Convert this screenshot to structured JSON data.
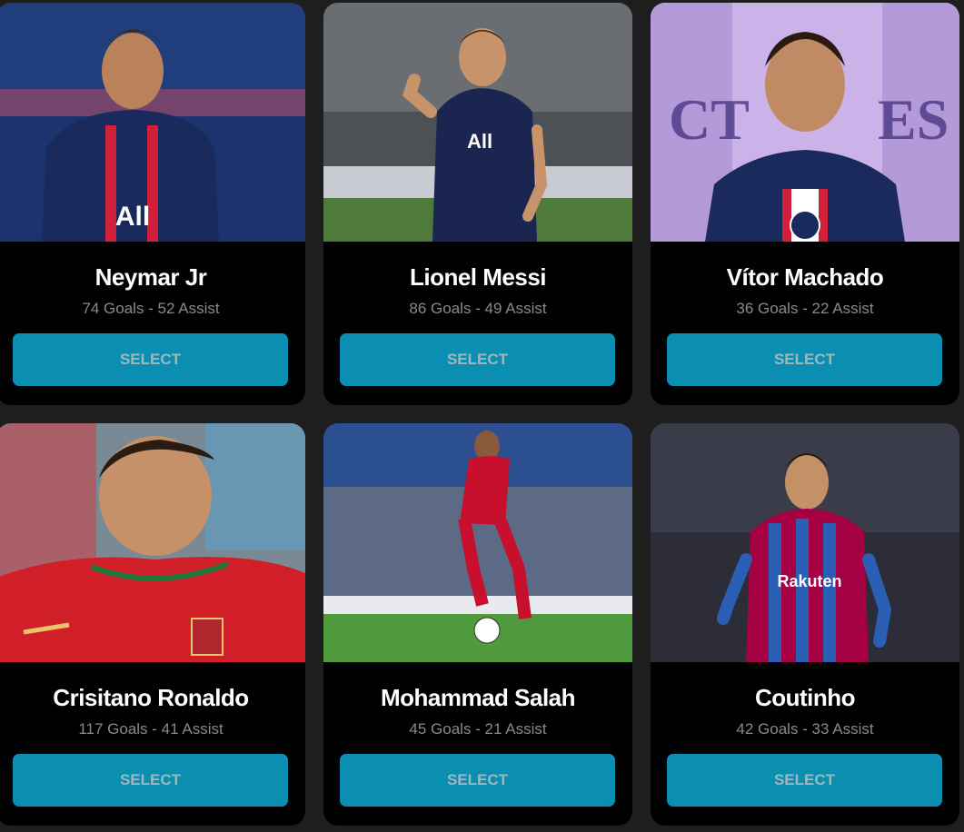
{
  "players": [
    {
      "name": "Neymar Jr",
      "stats": "74 Goals - 52 Assist",
      "button": "SELECT",
      "photo": "photo-neymar",
      "bg": "#1f3a7a",
      "shirt": "#1b2a5c",
      "stripe": "#d0203a"
    },
    {
      "name": "Lionel Messi",
      "stats": "86 Goals - 49 Assist",
      "button": "SELECT",
      "photo": "photo-messi",
      "bg": "#5a5e62",
      "shirt": "#1a2550",
      "stripe": "#1a2550"
    },
    {
      "name": "Vítor Machado",
      "stats": "36 Goals - 22 Assist",
      "button": "SELECT",
      "photo": "photo-machado",
      "bg": "#c9b0e8",
      "shirt": "#1b2a5c",
      "stripe": "#d0203a"
    },
    {
      "name": "Crisitano Ronaldo",
      "stats": "117 Goals - 41 Assist",
      "button": "SELECT",
      "photo": "photo-ronaldo",
      "bg": "#6a7e8a",
      "shirt": "#d11f2a",
      "stripe": "#1f7a3a"
    },
    {
      "name": "Mohammad Salah",
      "stats": "45 Goals - 21 Assist",
      "button": "SELECT",
      "photo": "photo-salah",
      "bg": "#2a4f8f",
      "shirt": "#c8102e",
      "stripe": "#c8102e"
    },
    {
      "name": "Coutinho",
      "stats": "42 Goals - 33 Assist",
      "button": "SELECT",
      "photo": "photo-coutinho",
      "bg": "#2a2a34",
      "shirt": "#a50044",
      "stripe": "#2a5fb5"
    }
  ],
  "colors": {
    "page_bg": "#1e1e1e",
    "card_bg": "#000000",
    "button_bg": "#0a8fb2",
    "button_text": "#9fb7bf",
    "stats_text": "#8a8a8a"
  }
}
